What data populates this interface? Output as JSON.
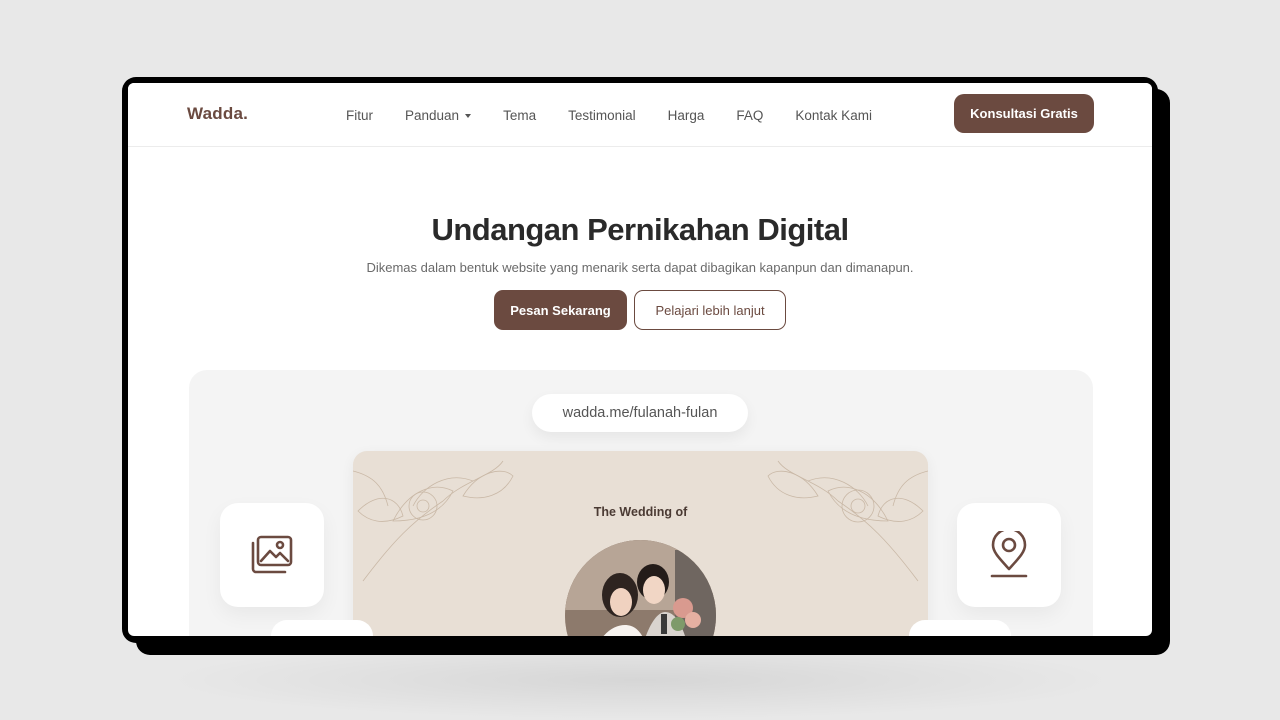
{
  "brand": {
    "logo": "Wadda.",
    "accent": "#6b4a40"
  },
  "nav": {
    "items": [
      {
        "label": "Fitur"
      },
      {
        "label": "Panduan",
        "dropdown": true
      },
      {
        "label": "Tema"
      },
      {
        "label": "Testimonial"
      },
      {
        "label": "Harga"
      },
      {
        "label": "FAQ"
      },
      {
        "label": "Kontak Kami"
      }
    ],
    "cta": "Konsultasi Gratis"
  },
  "hero": {
    "title": "Undangan Pernikahan Digital",
    "subtitle": "Dikemas dalam bentuk website yang menarik serta dapat dibagikan kapanpun dan dimanapun.",
    "primary_button": "Pesan Sekarang",
    "secondary_button": "Pelajari lebih lanjut"
  },
  "preview": {
    "url": "wadda.me/fulanah-fulan",
    "card_heading": "The Wedding of",
    "card_background": "#e8dfd5",
    "left_tile_icon": "gallery-icon",
    "right_tile_icon": "location-pin-icon"
  }
}
